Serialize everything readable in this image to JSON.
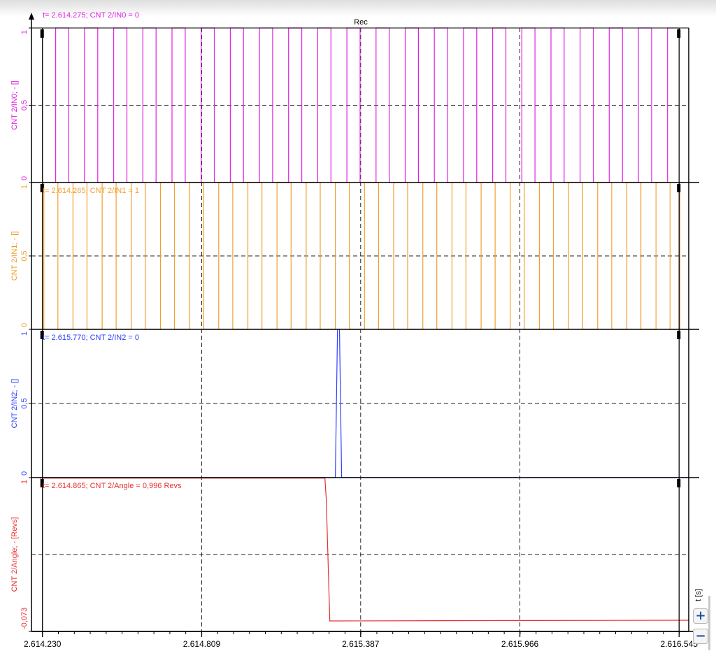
{
  "header": {
    "title": "Rec"
  },
  "x_unit_label": "t [s]",
  "controls": {
    "zoom_in": "+",
    "zoom_out": "−"
  },
  "colors": {
    "in0": "#e022e0",
    "in1": "#f0a030",
    "in2": "#2f40ff",
    "angle": "#e83030",
    "grid": "#222222",
    "axis": "#000000"
  },
  "chart_data": {
    "type": "line",
    "x_range": [
      2.61419,
      2.61658
    ],
    "x_ticks": [
      {
        "value": 2.61423,
        "label": "2.614.230"
      },
      {
        "value": 2.614809,
        "label": "2.614.809"
      },
      {
        "value": 2.615387,
        "label": "2.615.387"
      },
      {
        "value": 2.615966,
        "label": "2.615.966"
      },
      {
        "value": 2.616545,
        "label": "2.616.545"
      }
    ],
    "cursors": [
      {
        "value": 2.61423
      },
      {
        "value": 2.616545
      }
    ],
    "panels": [
      {
        "key": "in0",
        "ylabel": "CNT 2/IN0; - []",
        "ylim": [
          0,
          1
        ],
        "y_ticks": [
          {
            "value": 1,
            "label": "1"
          },
          {
            "value": 0.5,
            "label": "0,5"
          },
          {
            "value": 0,
            "label": "0"
          }
        ],
        "cursor_text": "t= 2.614.275; CNT 2/IN0 = 0",
        "signal": {
          "kind": "square",
          "start": 2.614265,
          "end": 2.616543,
          "low": 0,
          "high": 1,
          "edges": [
            2.614278,
            2.614325,
            2.614383,
            2.614431,
            2.614489,
            2.614537,
            2.614595,
            2.614643,
            2.614701,
            2.614749,
            2.614807,
            2.614855,
            2.614913,
            2.614961,
            2.615019,
            2.615067,
            2.615125,
            2.615173,
            2.615231,
            2.615279,
            2.615337,
            2.615385,
            2.615443,
            2.615491,
            2.615549,
            2.615597,
            2.615655,
            2.615703,
            2.615761,
            2.615809,
            2.615867,
            2.615915,
            2.615973,
            2.616021,
            2.616079,
            2.616127,
            2.616185,
            2.616233,
            2.616291,
            2.616339,
            2.616397,
            2.616445,
            2.616503
          ]
        }
      },
      {
        "key": "in1",
        "ylabel": "CNT 2/IN1; - []",
        "ylim": [
          0,
          1
        ],
        "y_ticks": [
          {
            "value": 1,
            "label": "1"
          },
          {
            "value": 0.5,
            "label": "0,5"
          },
          {
            "value": 0,
            "label": "0"
          }
        ],
        "cursor_text": "t= 2.614.265; CNT 2/IN1 = 1",
        "signal": {
          "kind": "square",
          "start": 2.61422,
          "end": 2.61656,
          "low": 0,
          "high": 1,
          "edges": [
            2.614235,
            2.614286,
            2.614341,
            2.614392,
            2.614447,
            2.614498,
            2.614553,
            2.614604,
            2.614659,
            2.61471,
            2.614765,
            2.614816,
            2.614871,
            2.614922,
            2.614977,
            2.615028,
            2.615083,
            2.615134,
            2.615189,
            2.61524,
            2.615295,
            2.615346,
            2.615401,
            2.615452,
            2.615507,
            2.615558,
            2.615613,
            2.615664,
            2.615719,
            2.61577,
            2.615825,
            2.615876,
            2.615931,
            2.615982,
            2.616037,
            2.616088,
            2.616143,
            2.616194,
            2.616249,
            2.6163,
            2.616355,
            2.616406,
            2.616461,
            2.616512,
            2.616548
          ]
        }
      },
      {
        "key": "in2",
        "ylabel": "CNT 2/IN2; - []",
        "ylim": [
          0,
          1
        ],
        "y_ticks": [
          {
            "value": 1,
            "label": "1"
          },
          {
            "value": 0.5,
            "label": "0,5"
          },
          {
            "value": 0,
            "label": "0"
          }
        ],
        "cursor_text": "t= 2.615.770; CNT 2/IN2 = 0",
        "signal": {
          "kind": "points",
          "points": [
            [
              2.61422,
              0
            ],
            [
              2.615295,
              0
            ],
            [
              2.615303,
              1
            ],
            [
              2.61531,
              1
            ],
            [
              2.615318,
              0
            ],
            [
              2.61658,
              0
            ]
          ]
        }
      },
      {
        "key": "angle",
        "ylabel": "CNT 2/Angle; - [Revs]",
        "ylim": [
          -0.073,
          1
        ],
        "y_ticks": [
          {
            "value": 1,
            "label": "1"
          },
          {
            "value": -0.073,
            "label": "-0,073"
          }
        ],
        "cursor_text": "t= 2.614.865; CNT 2/Angle = 0,996 Revs",
        "signal": {
          "kind": "points",
          "points": [
            [
              2.61422,
              0.996
            ],
            [
              2.615257,
              0.996
            ],
            [
              2.615262,
              0.85
            ],
            [
              2.615275,
              0
            ],
            [
              2.616,
              0.003
            ],
            [
              2.61658,
              0.005
            ]
          ]
        }
      }
    ]
  }
}
